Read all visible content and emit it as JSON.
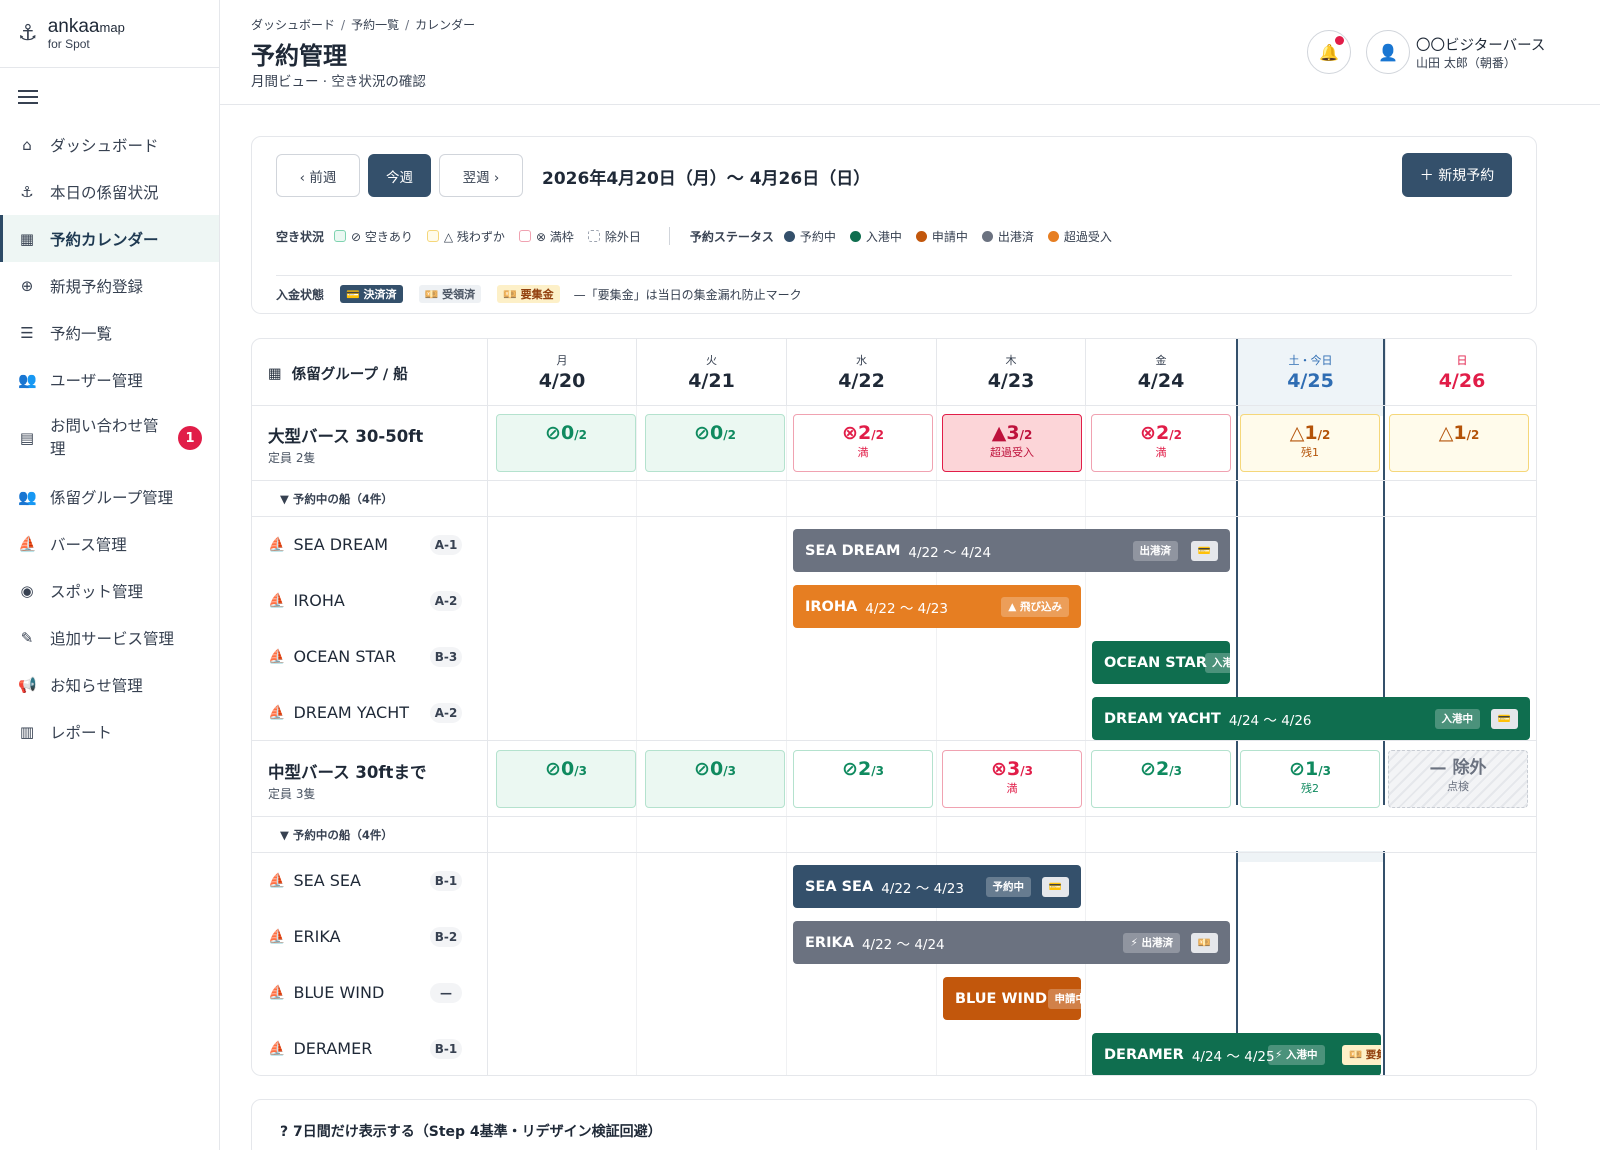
{
  "app": {
    "logo_main": "ankaa",
    "logo_small": "map",
    "logo_sub": "for Spot"
  },
  "nav": {
    "items": [
      {
        "label": "ダッシュボード",
        "icon": "home-icon"
      },
      {
        "label": "本日の係留状況",
        "icon": "anchor-icon"
      },
      {
        "label": "予約カレンダー",
        "icon": "calendar-icon",
        "active": true
      },
      {
        "label": "新規予約登録",
        "icon": "plus-circle-icon"
      },
      {
        "label": "予約一覧",
        "icon": "list-icon"
      },
      {
        "label": "ユーザー管理",
        "icon": "users-icon"
      },
      {
        "label": "お問い合わせ管理",
        "icon": "chat-icon",
        "badge": "1"
      },
      {
        "label": "係留グループ管理",
        "icon": "group-icon"
      },
      {
        "label": "バース管理",
        "icon": "boat-icon"
      },
      {
        "label": "スポット管理",
        "icon": "pin-icon"
      },
      {
        "label": "追加サービス管理",
        "icon": "service-icon"
      },
      {
        "label": "お知らせ管理",
        "icon": "megaphone-icon"
      },
      {
        "label": "レポート",
        "icon": "report-icon"
      }
    ]
  },
  "header": {
    "breadcrumb": [
      "ダッシュボード",
      "予約一覧",
      "カレンダー"
    ],
    "title": "予約管理",
    "subtitle": "月間ビュー · 空き状況の確認",
    "user_name": "〇〇ビジターバース",
    "user_role": "山田 太郎（朝番）"
  },
  "toolbar": {
    "prev": "‹  前週",
    "today": "今週",
    "next": "翌週  ›",
    "range": "2026年4月20日（月）〜 4月26日（日）",
    "new": "＋ 新規予約"
  },
  "legend": {
    "availability_label": "空き状況",
    "availability": [
      "⊘ 空きあり",
      "△ 残わずか",
      "⊗ 満枠",
      "除外日"
    ],
    "status_label": "予約ステータス",
    "statuses": [
      {
        "label": "予約中",
        "color": "#34506b"
      },
      {
        "label": "入港中",
        "color": "#0f6e4f"
      },
      {
        "label": "申請中",
        "color": "#c2570c"
      },
      {
        "label": "出港済",
        "color": "#6b7280"
      },
      {
        "label": "超過受入",
        "color": "#e67e22"
      }
    ],
    "payment_label": "入金状態",
    "payments": [
      "💳 決済済",
      "💴 受領済",
      "💴 要集金"
    ],
    "payment_note": "—「要集金」は当日の集金漏れ防止マーク"
  },
  "calendar": {
    "corner_label": "係留グループ / 船",
    "days": [
      {
        "dow": "月",
        "date": "4/20"
      },
      {
        "dow": "火",
        "date": "4/21"
      },
      {
        "dow": "水",
        "date": "4/22"
      },
      {
        "dow": "木",
        "date": "4/23"
      },
      {
        "dow": "金",
        "date": "4/24"
      },
      {
        "dow": "土・今日",
        "date": "4/25"
      },
      {
        "dow": "日",
        "date": "4/26"
      }
    ],
    "groups": [
      {
        "name": "大型バース 30-50ft",
        "capacity": "定員 2隻",
        "cells": [
          {
            "icon": "⊘",
            "num": "0",
            "cap": "/2",
            "note": "",
            "state": "ok"
          },
          {
            "icon": "⊘",
            "num": "0",
            "cap": "/2",
            "note": "",
            "state": "ok"
          },
          {
            "icon": "⊗",
            "num": "2",
            "cap": "/2",
            "note": "満",
            "state": "full"
          },
          {
            "icon": "▲",
            "num": "3",
            "cap": "/2",
            "note": "超過受入",
            "state": "over"
          },
          {
            "icon": "⊗",
            "num": "2",
            "cap": "/2",
            "note": "満",
            "state": "full"
          },
          {
            "icon": "△",
            "num": "1",
            "cap": "/2",
            "note": "残1",
            "state": "few"
          },
          {
            "icon": "△",
            "num": "1",
            "cap": "/2",
            "note": "",
            "state": "few"
          }
        ],
        "sub_label": "▼ 予約中の船（4件）",
        "boats": [
          {
            "name": "SEA DREAM",
            "code": "A-1"
          },
          {
            "name": "IROHA",
            "code": "A-2"
          },
          {
            "name": "OCEAN STAR",
            "code": "B-3"
          },
          {
            "name": "DREAM YACHT",
            "code": "A-2"
          }
        ],
        "bars": [
          {
            "name": "SEA DREAM",
            "dates": "4/22 〜 4/24",
            "tag": "出港済",
            "pay": "💳"
          },
          {
            "name": "IROHA",
            "dates": "4/22 〜 4/23",
            "tag": "▲ 飛び込み",
            "pay": ""
          },
          {
            "name": "OCEAN STAR",
            "dates": "",
            "tag": "入港",
            "pay": ""
          },
          {
            "name": "DREAM YACHT",
            "dates": "4/24 〜 4/26",
            "tag": "入港中",
            "pay": "💳"
          }
        ]
      },
      {
        "name": "中型バース 30ftまで",
        "capacity": "定員 3隻",
        "cells": [
          {
            "icon": "⊘",
            "num": "0",
            "cap": "/3",
            "note": "",
            "state": "ok"
          },
          {
            "icon": "⊘",
            "num": "0",
            "cap": "/3",
            "note": "",
            "state": "ok"
          },
          {
            "icon": "⊘",
            "num": "2",
            "cap": "/3",
            "note": "",
            "state": "okw"
          },
          {
            "icon": "⊗",
            "num": "3",
            "cap": "/3",
            "note": "満",
            "state": "full"
          },
          {
            "icon": "⊘",
            "num": "2",
            "cap": "/3",
            "note": "",
            "state": "okw"
          },
          {
            "icon": "⊘",
            "num": "1",
            "cap": "/3",
            "note": "残2",
            "state": "okw"
          },
          {
            "icon": "—",
            "num": "除外",
            "cap": "",
            "note": "点検",
            "state": "ex"
          }
        ],
        "sub_label": "▼ 予約中の船（4件）",
        "boats": [
          {
            "name": "SEA SEA",
            "code": "B-1"
          },
          {
            "name": "ERIKA",
            "code": "B-2"
          },
          {
            "name": "BLUE WIND",
            "code": "—"
          },
          {
            "name": "DERAMER",
            "code": "B-1"
          }
        ],
        "bars": [
          {
            "name": "SEA SEA",
            "dates": "4/22 〜 4/23",
            "tag": "予約中",
            "pay": "💳"
          },
          {
            "name": "ERIKA",
            "dates": "4/22 〜 4/24",
            "tag": "⚡ 出港済",
            "pay": "💴"
          },
          {
            "name": "BLUE WIND",
            "dates": "",
            "tag": "申請中",
            "pay": ""
          },
          {
            "name": "DERAMER",
            "dates": "4/24 〜 4/25",
            "tag": "⚡ 入港中",
            "pay": "💴 要集"
          }
        ]
      }
    ]
  },
  "footer_card": {
    "title": "? 7日間だけ表示する（Step 4基準・リデザイン検証回避）"
  }
}
